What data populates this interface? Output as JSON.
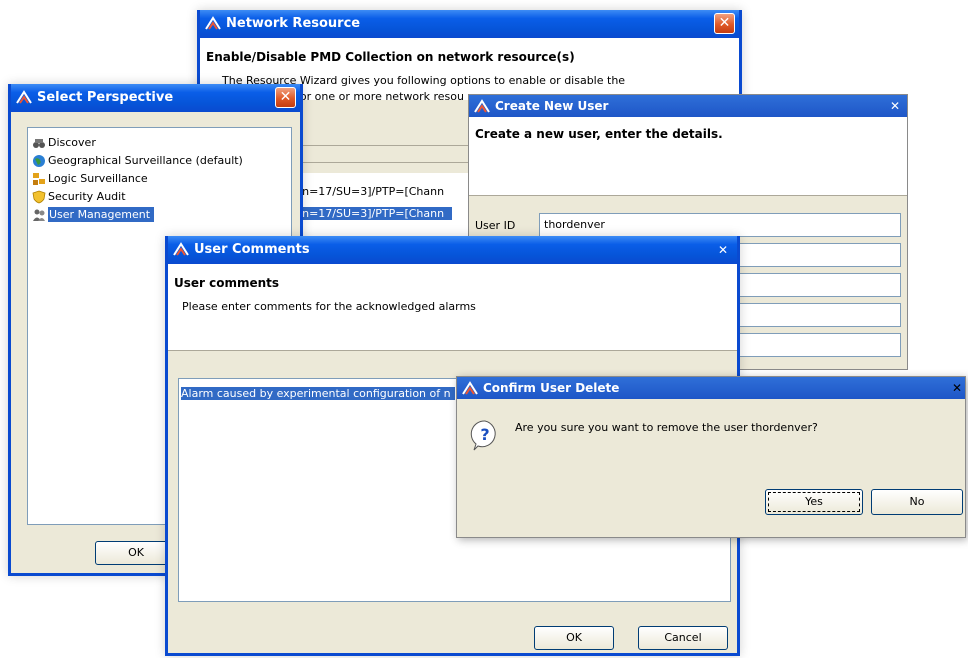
{
  "network_resource": {
    "title": "Network Resource",
    "heading": "Enable/Disable PMD Collection on network resource(s)",
    "line1": "The Resource Wizard gives you following options to enable or disable the",
    "line2": "for one or more network resou",
    "list_item_1": "tion=17/SU=3]/PTP=[Chann",
    "list_item_2": "tion=17/SU=3]/PTP=[Chann"
  },
  "select_perspective": {
    "title": "Select Perspective",
    "items": [
      {
        "label": "Discover",
        "icon": "binoculars-icon"
      },
      {
        "label": "Geographical Surveillance (default)",
        "icon": "globe-icon"
      },
      {
        "label": "Logic Surveillance",
        "icon": "network-icon"
      },
      {
        "label": "Security Audit",
        "icon": "shield-icon"
      },
      {
        "label": "User Management",
        "icon": "users-icon",
        "selected": true
      }
    ],
    "ok_label": "OK"
  },
  "create_user": {
    "title": "Create New User",
    "heading": "Create a new user, enter the details.",
    "user_id_label": "User ID",
    "user_id_value": "thordenver"
  },
  "user_comments": {
    "title": "User Comments",
    "heading": "User comments",
    "subtext": "Please enter comments for the acknowledged alarms",
    "comment_text": "Alarm caused by experimental configuration of n",
    "ok_label": "OK",
    "cancel_label": "Cancel"
  },
  "confirm_delete": {
    "title": "Confirm User Delete",
    "message": "Are you sure you want to remove the user thordenver?",
    "yes_label": "Yes",
    "no_label": "No",
    "icon": "question-icon"
  },
  "colors": {
    "xp_title": "#0a5ee8",
    "selection": "#316ac5",
    "dialog_bg": "#ece9d8"
  }
}
